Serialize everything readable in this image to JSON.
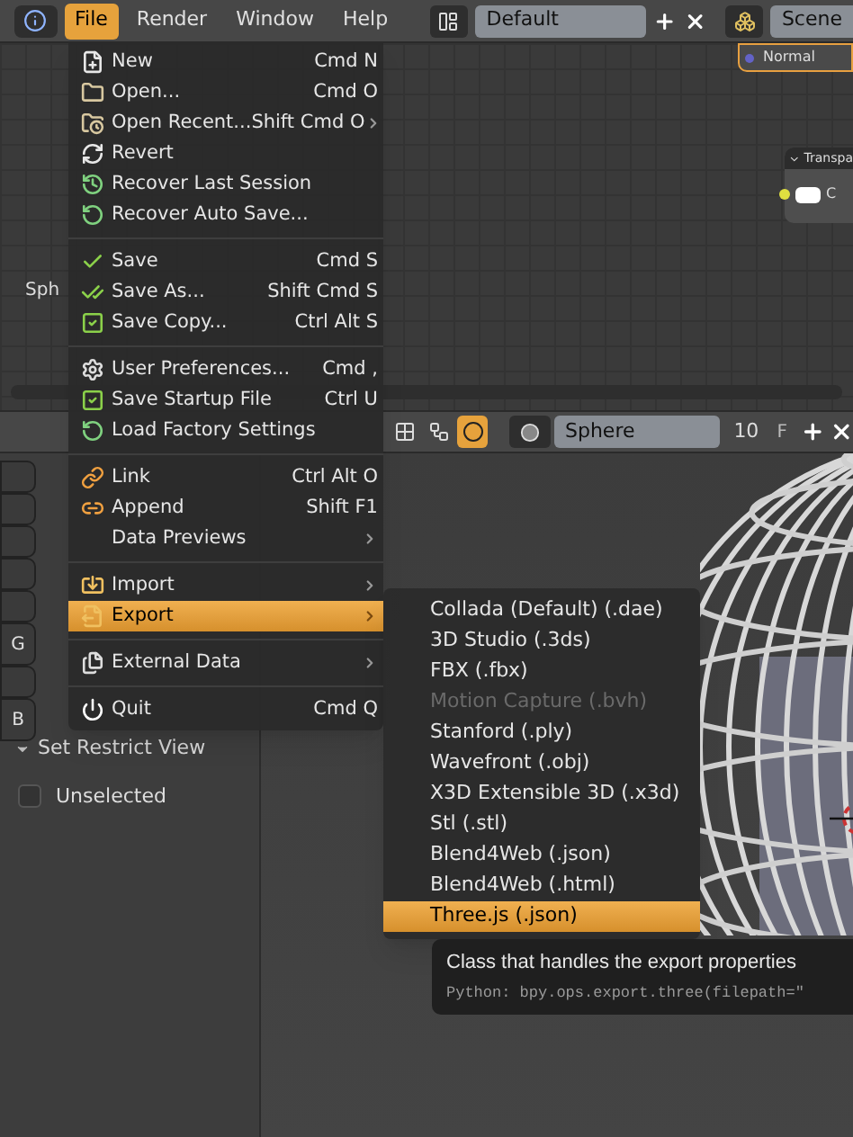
{
  "top_header": {
    "menus": [
      {
        "label": "File",
        "selected": true
      },
      {
        "label": "Render",
        "selected": false
      },
      {
        "label": "Window",
        "selected": false
      },
      {
        "label": "Help",
        "selected": false
      }
    ],
    "screen_layout": "Default",
    "scene": "Scene"
  },
  "node_editor": {
    "nodes": [
      {
        "kind": "socket",
        "label": "Normal"
      },
      {
        "kind": "panel",
        "label": "Transpa",
        "socket_label": "C"
      }
    ],
    "side_label": "Sph"
  },
  "node_header": {
    "shader_types": [
      {
        "selected": false
      },
      {
        "selected": false
      },
      {
        "selected": true
      }
    ],
    "material": "Sphere",
    "users": "10",
    "fake_user": "F"
  },
  "tool_shelf": {
    "tabs": [
      "G",
      "B"
    ],
    "panel_title": "Set Restrict View",
    "checkbox": {
      "label": "Unselected",
      "checked": false
    }
  },
  "file_menu": {
    "groups": [
      [
        {
          "label": "New",
          "shortcut": "Cmd N",
          "submenu": false,
          "selected": false
        },
        {
          "label": "Open...",
          "shortcut": "Cmd O",
          "submenu": false,
          "selected": false
        },
        {
          "label": "Open Recent...",
          "shortcut": "Shift Cmd O",
          "submenu": true,
          "selected": false
        },
        {
          "label": "Revert",
          "submenu": false,
          "selected": false
        },
        {
          "label": "Recover Last Session",
          "submenu": false,
          "selected": false
        },
        {
          "label": "Recover Auto Save...",
          "submenu": false,
          "selected": false
        }
      ],
      [
        {
          "label": "Save",
          "shortcut": "Cmd S",
          "submenu": false,
          "selected": false
        },
        {
          "label": "Save As...",
          "shortcut": "Shift Cmd S",
          "submenu": false,
          "selected": false
        },
        {
          "label": "Save Copy...",
          "shortcut": "Ctrl Alt S",
          "submenu": false,
          "selected": false
        }
      ],
      [
        {
          "label": "User Preferences...",
          "shortcut": "Cmd ,",
          "submenu": false,
          "selected": false
        },
        {
          "label": "Save Startup File",
          "shortcut": "Ctrl U",
          "submenu": false,
          "selected": false
        },
        {
          "label": "Load Factory Settings",
          "submenu": false,
          "selected": false
        }
      ],
      [
        {
          "label": "Link",
          "shortcut": "Ctrl Alt O",
          "submenu": false,
          "selected": false
        },
        {
          "label": "Append",
          "shortcut": "Shift F1",
          "submenu": false,
          "selected": false
        },
        {
          "label": "Data Previews",
          "submenu": true,
          "selected": false
        }
      ],
      [
        {
          "label": "Import",
          "submenu": true,
          "selected": false
        },
        {
          "label": "Export",
          "submenu": true,
          "selected": true
        }
      ],
      [
        {
          "label": "External Data",
          "submenu": true,
          "selected": false
        }
      ],
      [
        {
          "label": "Quit",
          "shortcut": "Cmd Q",
          "submenu": false,
          "selected": false
        }
      ]
    ]
  },
  "export_menu": {
    "items": [
      {
        "label": "Collada (Default) (.dae)",
        "disabled": false,
        "selected": false
      },
      {
        "label": "3D Studio (.3ds)",
        "disabled": false,
        "selected": false
      },
      {
        "label": "FBX (.fbx)",
        "disabled": false,
        "selected": false
      },
      {
        "label": "Motion Capture (.bvh)",
        "disabled": true,
        "selected": false
      },
      {
        "label": "Stanford (.ply)",
        "disabled": false,
        "selected": false
      },
      {
        "label": "Wavefront (.obj)",
        "disabled": false,
        "selected": false
      },
      {
        "label": "X3D Extensible 3D (.x3d)",
        "disabled": false,
        "selected": false
      },
      {
        "label": "Stl (.stl)",
        "disabled": false,
        "selected": false
      },
      {
        "label": "Blend4Web (.json)",
        "disabled": false,
        "selected": false
      },
      {
        "label": "Blend4Web (.html)",
        "disabled": false,
        "selected": false
      },
      {
        "label": "Three.js (.json)",
        "disabled": false,
        "selected": true
      }
    ]
  },
  "tooltip": {
    "description": "Class that handles the export properties",
    "python": "Python: bpy.ops.export.three(filepath=\""
  }
}
